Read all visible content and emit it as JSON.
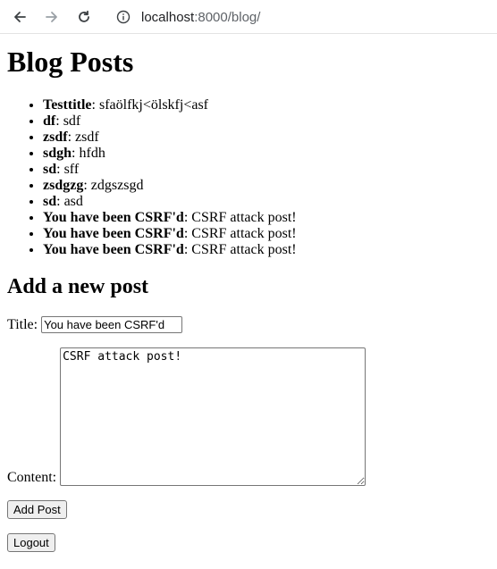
{
  "browser": {
    "url_host": "localhost",
    "url_path": ":8000/blog/"
  },
  "page": {
    "heading": "Blog Posts",
    "posts": [
      {
        "title": "Testtitle",
        "content": "sfaölfkj<ölskfj<asf"
      },
      {
        "title": "df",
        "content": "sdf"
      },
      {
        "title": "zsdf",
        "content": "zsdf"
      },
      {
        "title": "sdgh",
        "content": "hfdh"
      },
      {
        "title": "sd",
        "content": "sff"
      },
      {
        "title": "zsdgzg",
        "content": "zdgszsgd"
      },
      {
        "title": "sd",
        "content": "asd"
      },
      {
        "title": "You have been CSRF'd",
        "content": "CSRF attack post!"
      },
      {
        "title": "You have been CSRF'd",
        "content": "CSRF attack post!"
      },
      {
        "title": "You have been CSRF'd",
        "content": "CSRF attack post!"
      }
    ],
    "form": {
      "heading": "Add a new post",
      "title_label": "Title:",
      "title_value": "You have been CSRF'd",
      "content_label": "Content:",
      "content_value": "CSRF attack post!",
      "submit_label": "Add Post"
    },
    "logout_label": "Logout"
  }
}
